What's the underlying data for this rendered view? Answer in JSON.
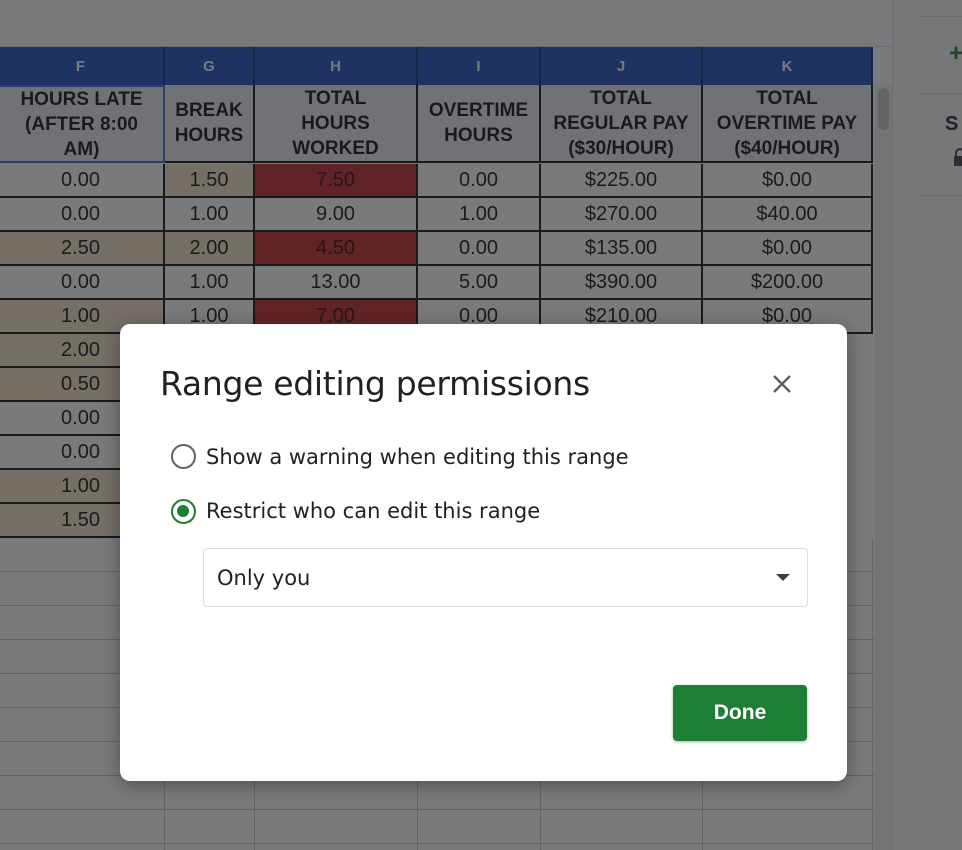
{
  "sheet": {
    "column_letters": [
      "F",
      "G",
      "H",
      "I",
      "J",
      "K"
    ],
    "headers": [
      "HOURS LATE\n(AFTER 8:00\nAM)",
      "BREAK\nHOURS",
      "TOTAL\nHOURS\nWORKED",
      "OVERTIME\nHOURS",
      "TOTAL\nREGULAR PAY\n($30/HOUR)",
      "TOTAL\nOVERTIME PAY\n($40/HOUR)"
    ],
    "rows": [
      [
        "0.00",
        "1.50",
        "7.50",
        "0.00",
        "$225.00",
        "$0.00"
      ],
      [
        "0.00",
        "1.00",
        "9.00",
        "1.00",
        "$270.00",
        "$40.00"
      ],
      [
        "2.50",
        "2.00",
        "4.50",
        "0.00",
        "$135.00",
        "$0.00"
      ],
      [
        "0.00",
        "1.00",
        "13.00",
        "5.00",
        "$390.00",
        "$200.00"
      ],
      [
        "1.00",
        "1.00",
        "7.00",
        "0.00",
        "$210.00",
        "$0.00"
      ],
      [
        "2.00",
        "",
        "",
        "",
        "",
        ""
      ],
      [
        "0.50",
        "",
        "",
        "",
        "",
        ""
      ],
      [
        "0.00",
        "",
        "",
        "",
        "",
        ""
      ],
      [
        "0.00",
        "",
        "",
        "",
        "",
        ""
      ],
      [
        "1.00",
        "",
        "",
        "",
        "",
        ""
      ],
      [
        "1.50",
        "",
        "",
        "",
        "",
        ""
      ]
    ],
    "tan_cells": [
      "2-0",
      "4-0",
      "5-0",
      "6-0",
      "9-0",
      "10-0",
      "0-1",
      "2-1"
    ],
    "red_cells": [
      "0-2",
      "2-2",
      "4-2"
    ]
  },
  "side_panel": {
    "add_label": "+",
    "truncated_label": "S"
  },
  "dialog": {
    "title": "Range editing permissions",
    "options": [
      {
        "label": "Show a warning when editing this range",
        "checked": false
      },
      {
        "label": "Restrict who can edit this range",
        "checked": true
      }
    ],
    "select_value": "Only you",
    "done_label": "Done"
  },
  "colors": {
    "accent_green": "#1e7e34",
    "header_blue": "#1f4fbf",
    "tan_fill": "#f4e3c8",
    "red_fill": "#c42a2a"
  },
  "icons": {
    "close": "close-icon",
    "dropdown": "chevron-down-icon",
    "lock": "lock-icon"
  }
}
